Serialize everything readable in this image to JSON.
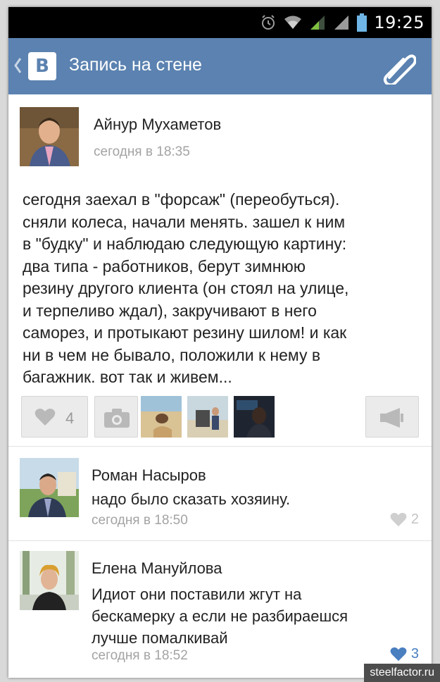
{
  "status_bar": {
    "time": "19:25",
    "icons": [
      "alarm-icon",
      "wifi-icon",
      "signal-icon",
      "signal-icon",
      "battery-icon"
    ]
  },
  "header": {
    "logo_letter": "B",
    "title": "Запись на стене",
    "icons": [
      "back-chevron-icon",
      "paperclip-icon"
    ]
  },
  "post": {
    "author": "Айнур Мухаметов",
    "time": "сегодня в 18:35",
    "text": "сегодня заехал в \"форсаж\" (переобуться).\nсняли колеса, начали менять. зашел к ним\nв \"будку\" и наблюдаю следующую картину:\nдва типа - работников, берут зимнюю\nрезину другого клиента (он стоял на улице,\nи терпеливо ждал), закручивают в него\nсаморез, и протыкают резину шилом! и как\nни в чем не бывало, положили к нему в\nбагажник. вот так и живем...",
    "likes": "4",
    "icons": [
      "heart-icon",
      "camera-icon",
      "megaphone-icon"
    ]
  },
  "comments": [
    {
      "author": "Роман Насыров",
      "text": "надо было сказать хозяину.",
      "time": "сегодня в 18:50",
      "likes": "2",
      "liked": false
    },
    {
      "author": "Елена Мануйлова",
      "text": "Идиот они поставили жгут на\nбескамерку  а если не разбираешся\nлучше помалкивай",
      "time": "сегодня в 18:52",
      "likes": "3",
      "liked": true
    }
  ],
  "watermark": "steelfactor.ru",
  "colors": {
    "header": "#5b82b0",
    "status_bar": "#000000",
    "text": "#222222",
    "muted": "#a3a3a3",
    "liked_heart": "#4a7fc0",
    "unliked_heart": "#cfcfcf"
  }
}
